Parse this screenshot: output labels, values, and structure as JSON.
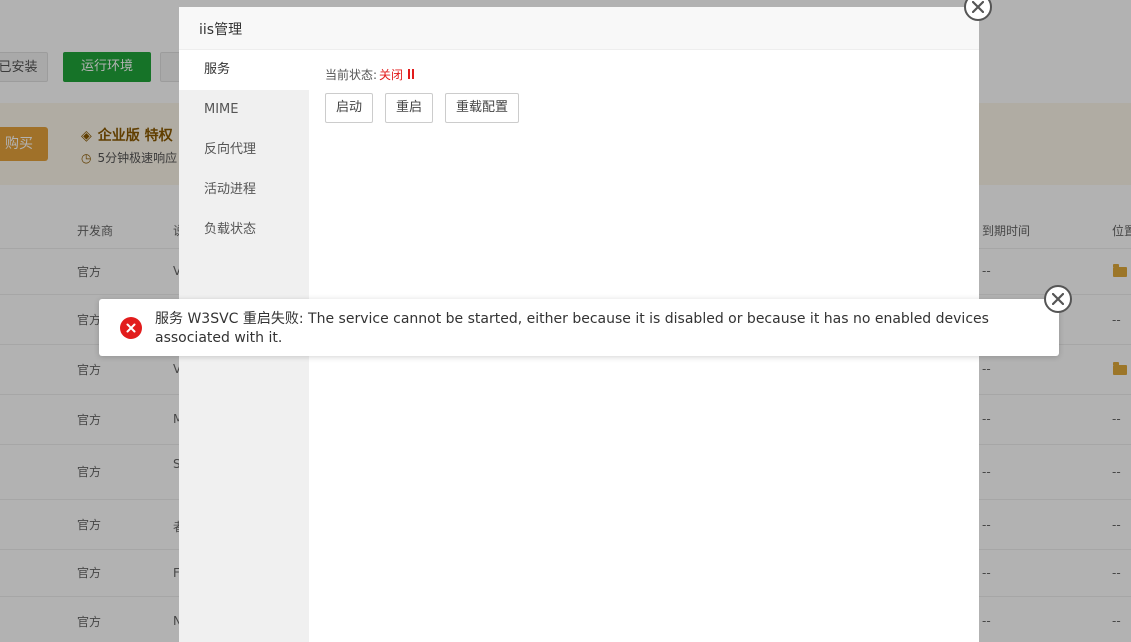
{
  "background": {
    "buttons": {
      "installed": "已安装",
      "runtime": "运行环境"
    },
    "banner": {
      "buy": "购买",
      "title": "企业版 特权",
      "subtitle": "5分钟极速响应"
    },
    "table": {
      "headers": {
        "developer": "开发商",
        "desc": "说",
        "expiry": "到期时间",
        "location": "位置"
      },
      "rows": [
        {
          "developer": "官方",
          "desc": "V",
          "expiry": "--",
          "location": "folder"
        },
        {
          "developer": "官方",
          "desc": "",
          "expiry": "",
          "location": "--"
        },
        {
          "developer": "官方",
          "desc": "V",
          "expiry": "--",
          "location": "folder"
        },
        {
          "developer": "官方",
          "desc": "M",
          "expiry": "--",
          "location": "--"
        },
        {
          "developer": "官方",
          "desc": "S",
          "expiry": "--",
          "location": "--"
        },
        {
          "developer": "官方",
          "desc": "者",
          "expiry": "--",
          "location": "--"
        },
        {
          "developer": "官方",
          "desc": "F",
          "expiry": "--",
          "location": "--"
        },
        {
          "developer": "官方",
          "desc": "N",
          "expiry": "--",
          "location": "--"
        }
      ]
    }
  },
  "dialog": {
    "title": "iis管理",
    "sidebar": [
      {
        "label": "服务",
        "active": true
      },
      {
        "label": "MIME",
        "active": false
      },
      {
        "label": "反向代理",
        "active": false
      },
      {
        "label": "活动进程",
        "active": false
      },
      {
        "label": "负载状态",
        "active": false
      }
    ],
    "status_label": "当前状态:",
    "status_value": "关闭",
    "buttons": {
      "start": "启动",
      "restart": "重启",
      "reload": "重载配置"
    }
  },
  "toast": {
    "message": "服务 W3SVC 重启失败: The service cannot be started, either because it is disabled or because it has no enabled devices associated with it."
  },
  "colors": {
    "accent": "#20a53a",
    "error": "#e21c1c",
    "warning": "#e6a23c"
  }
}
